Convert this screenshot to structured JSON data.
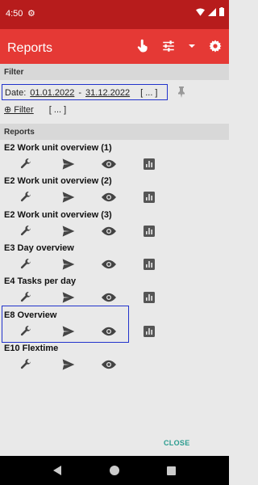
{
  "status_bar": {
    "time": "4:50"
  },
  "app_bar": {
    "title": "Reports"
  },
  "filter": {
    "header": "Filter",
    "date_label": "Date:",
    "date_from": "01.01.2022",
    "date_sep": "-",
    "date_to": "31.12.2022",
    "date_more": "[ ... ]",
    "filter_label": "⊕ Filter",
    "filter_more": "[ ... ]"
  },
  "reports": {
    "header": "Reports",
    "items": [
      {
        "name": "E2 Work unit overview (1)"
      },
      {
        "name": "E2 Work unit overview (2)"
      },
      {
        "name": "E2 Work unit overview (3)"
      },
      {
        "name": "E3 Day overview"
      },
      {
        "name": "E4 Tasks per day"
      },
      {
        "name": "E8 Overview"
      },
      {
        "name": "E10 Flextime"
      }
    ]
  },
  "footer": {
    "close_label": "CLOSE"
  },
  "colors": {
    "status_bar": "#b71c1c",
    "app_bar": "#e53935",
    "highlight": "#2233cc",
    "close": "#2a9c8f"
  }
}
